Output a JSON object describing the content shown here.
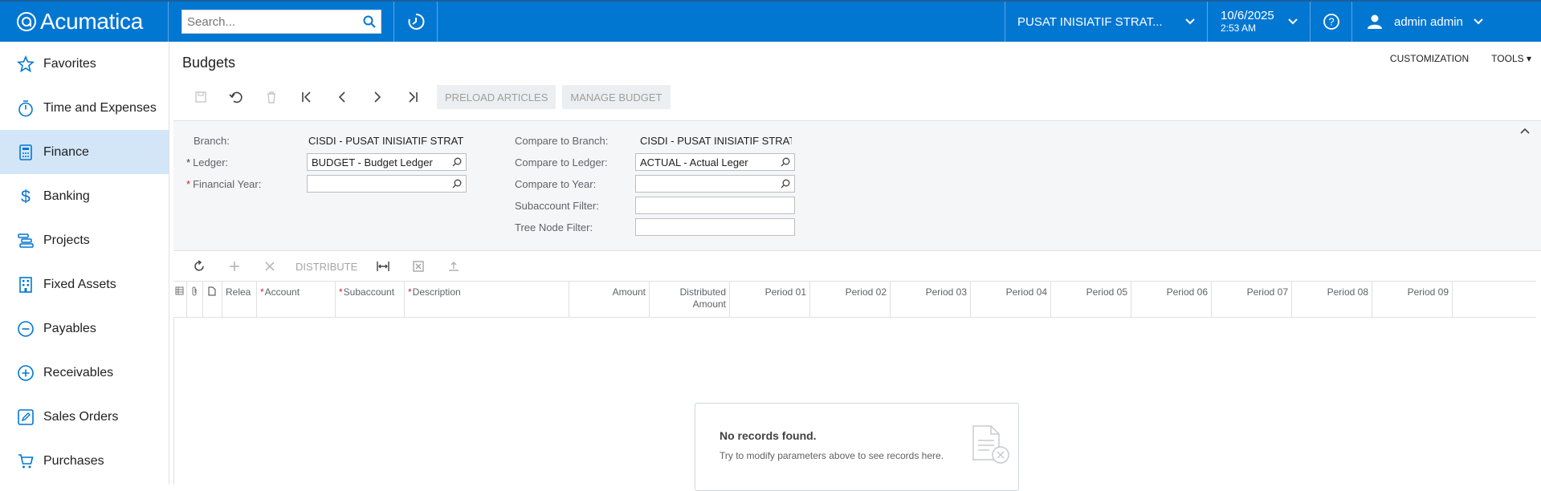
{
  "app": {
    "brand": "Acumatica"
  },
  "topbar": {
    "search_placeholder": "Search...",
    "branch": "PUSAT INISIATIF STRAT...",
    "date": "10/6/2025",
    "time": "2:53 AM",
    "user": "admin admin",
    "brand_color": "#0277d2"
  },
  "sidebar": {
    "items": [
      {
        "label": "Favorites",
        "icon": "star-icon"
      },
      {
        "label": "Time and Expenses",
        "icon": "stopwatch-icon"
      },
      {
        "label": "Finance",
        "icon": "calculator-icon",
        "active": true
      },
      {
        "label": "Banking",
        "icon": "dollar-icon"
      },
      {
        "label": "Projects",
        "icon": "projects-icon"
      },
      {
        "label": "Fixed Assets",
        "icon": "building-icon"
      },
      {
        "label": "Payables",
        "icon": "minus-circle-icon"
      },
      {
        "label": "Receivables",
        "icon": "plus-circle-icon"
      },
      {
        "label": "Sales Orders",
        "icon": "pencil-icon"
      },
      {
        "label": "Purchases",
        "icon": "cart-icon"
      }
    ]
  },
  "page": {
    "title": "Budgets",
    "customization": "CUSTOMIZATION",
    "tools": "TOOLS",
    "preload_articles": "PRELOAD ARTICLES",
    "manage_budget": "MANAGE BUDGET"
  },
  "form": {
    "branch_label": "Branch:",
    "branch_value": "CISDI - PUSAT INISIATIF STRAT",
    "ledger_label": "Ledger:",
    "ledger_value": "BUDGET - Budget Ledger",
    "year_label": "Financial Year:",
    "year_value": "",
    "cmp_branch_label": "Compare to Branch:",
    "cmp_branch_value": "CISDI - PUSAT INISIATIF STRAT",
    "cmp_ledger_label": "Compare to Ledger:",
    "cmp_ledger_value": "ACTUAL - Actual Leger",
    "cmp_year_label": "Compare to Year:",
    "cmp_year_value": "",
    "subaccount_filter_label": "Subaccount Filter:",
    "subaccount_filter_value": "",
    "tree_node_filter_label": "Tree Node Filter:",
    "tree_node_filter_value": ""
  },
  "grid": {
    "distribute": "DISTRIBUTE",
    "columns": {
      "released": "Relea",
      "account": "Account",
      "subaccount": "Subaccount",
      "description": "Description",
      "amount": "Amount",
      "distributed_1": "Distributed",
      "distributed_2": "Amount",
      "p01": "Period 01",
      "p02": "Period 02",
      "p03": "Period 03",
      "p04": "Period 04",
      "p05": "Period 05",
      "p06": "Period 06",
      "p07": "Period 07",
      "p08": "Period 08",
      "p09": "Period 09"
    },
    "empty_title": "No records found.",
    "empty_text": "Try to modify parameters above to see records here."
  }
}
